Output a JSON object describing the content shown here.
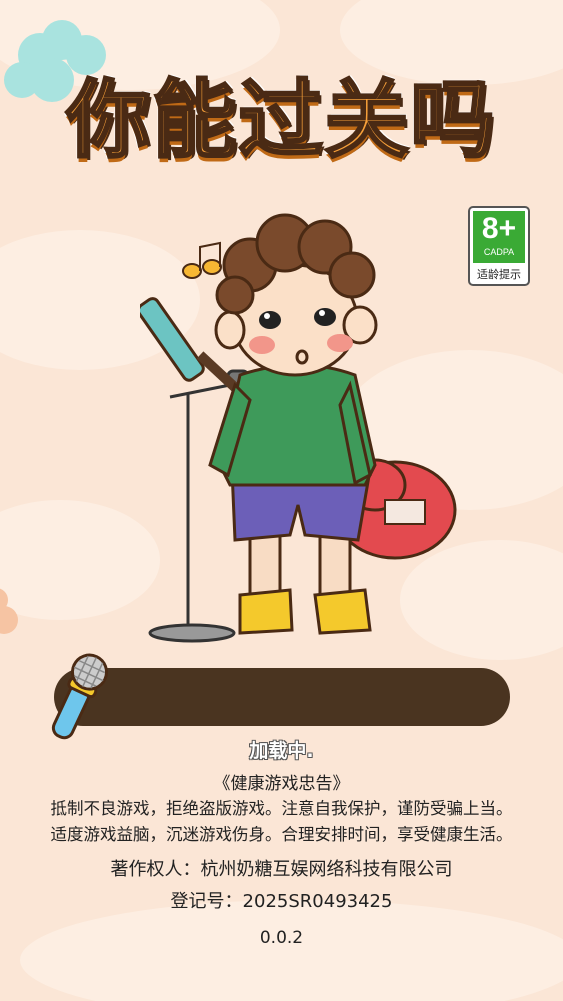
{
  "title": "你能过关吗",
  "age_rating": {
    "number": "8+",
    "org": "CADPA",
    "tip": "适龄提示",
    "color": "#3aaa35"
  },
  "progress": {
    "value": 0
  },
  "loading_text": "加载中.",
  "health_notice": {
    "title": "《健康游戏忠告》",
    "lines": [
      "抵制不良游戏，拒绝盗版游戏。注意自我保护，谨防受骗上当。",
      "适度游戏益脑，沉迷游戏伤身。合理安排时间，享受健康生活。"
    ]
  },
  "copyright_holder": "著作权人：杭州奶糖互娱网络科技有限公司",
  "registration_no": "登记号：2025SR0493425",
  "version": "0.0.2"
}
